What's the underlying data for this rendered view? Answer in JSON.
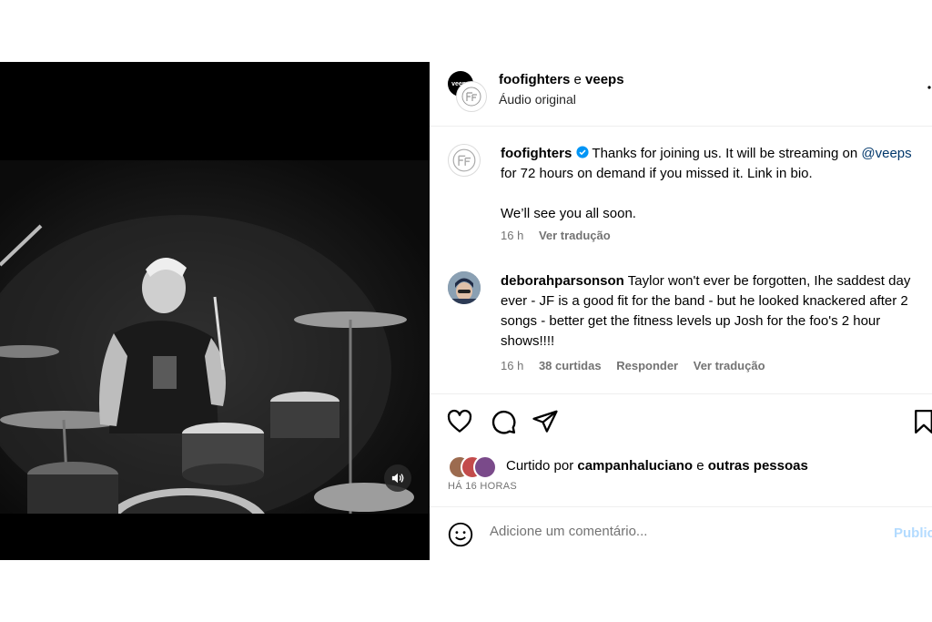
{
  "post": {
    "header": {
      "avatar_text": "veeps",
      "author": "foofighters",
      "connector": "e",
      "coauthor": "veeps",
      "audio": "Áudio original"
    },
    "caption": {
      "user": "foofighters",
      "verified": true,
      "part1": "Thanks for joining us. It will be streaming on ",
      "mention": "@veeps",
      "part2": " for 72 hours on demand if you missed it. Link in bio.",
      "line2": "We’ll see you all soon.",
      "time": "16 h",
      "translate": "Ver tradução"
    },
    "comments": [
      {
        "user": "deborahparsonson",
        "text": "Taylor won't ever be forgotten, Ihe saddest day ever - JF is a good fit for the band - but he looked knackered after 2 songs - better get the fitness levels up Josh for the foo's 2 hour shows!!!!",
        "time": "16 h",
        "likes": "38 curtidas",
        "reply": "Responder",
        "translate": "Ver tradução"
      }
    ],
    "liked": {
      "prefix": "Curtido por",
      "user": "campanhaluciano",
      "connector": "e",
      "others": "outras pessoas"
    },
    "timestamp": "HÁ 16 HORAS",
    "add_comment": {
      "placeholder": "Adicione um comentário...",
      "publish": "Publicar"
    }
  },
  "icons": {
    "like": "heart-icon",
    "comment": "comment-icon",
    "share": "share-icon",
    "save": "bookmark-icon",
    "emoji": "emoji-icon",
    "mute": "volume-icon",
    "verified": "verified-badge-icon"
  },
  "colors": {
    "mention": "#00376b",
    "verified": "#0095f6",
    "muted_text": "#737373",
    "publish": "#b3dbff"
  }
}
